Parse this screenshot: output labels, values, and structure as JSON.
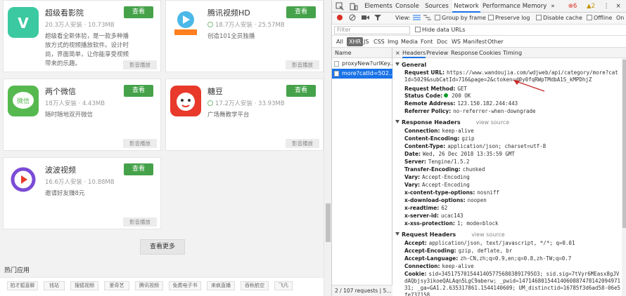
{
  "apps": [
    {
      "name": "超级看影院",
      "installs": "20.3万人安装",
      "size": "10.73MB",
      "desc": "超级看全新体验，是一款多种播放方式的视频播放软件。设计时尚，界面简单，让你能享受视频带来的乐趣。",
      "button": "查看",
      "tag": "影音播放",
      "color": "#3bc9a1"
    },
    {
      "name": "腾讯视频HD",
      "installs": "18.7万人安装",
      "size": "25.57MB",
      "desc": "创造101全员独播",
      "button": "查看",
      "tag": "影音播放",
      "color": "#ff7e1e"
    },
    {
      "name": "两个微信",
      "installs": "18万人安装",
      "size": "4.43MB",
      "desc": "随时随地双开微信",
      "button": "查看",
      "tag": "影音播放",
      "color": "#56b94f"
    },
    {
      "name": "糖豆",
      "installs": "17.2万人安装",
      "size": "33.93MB",
      "desc": "广场舞教学平台",
      "button": "查看",
      "tag": "影音播放",
      "color": "#e8392b"
    },
    {
      "name": "波波视频",
      "installs": "16.6万人安装",
      "size": "10.88MB",
      "desc": "邀请好友赚8元",
      "button": "查看",
      "tag": "影音播放",
      "color": "#7b4bd6"
    }
  ],
  "more_button": "查看更多",
  "hot": {
    "title": "热门应用",
    "items": [
      "拍才狐直聊",
      "钱站",
      "搜狐视频",
      "爱奇艺",
      "腾讯视频",
      "免费电子书",
      "来疯直播",
      "吞秋航空",
      "飞凡"
    ]
  },
  "devtools": {
    "tabs": [
      "Elements",
      "Console",
      "Sources",
      "Network",
      "Performance",
      "Memory"
    ],
    "active_tab": "Network",
    "badges": {
      "errors": "6",
      "warnings": "2"
    },
    "toolbar": {
      "view_label": "View:",
      "group_by_frame": "Group by frame",
      "preserve_log": "Preserve log",
      "disable_cache": "Disable cache",
      "offline": "Offline",
      "online": "On"
    },
    "filter": {
      "placeholder": "Filter",
      "hide_data_urls": "Hide data URLs"
    },
    "types": [
      "All",
      "XHR",
      "JS",
      "CSS",
      "Img",
      "Media",
      "Font",
      "Doc",
      "WS",
      "Manifest",
      "Other"
    ],
    "active_type": "XHR",
    "list": {
      "header": "Name",
      "requests": [
        "proxyNew?urlKey...",
        "more?catId=502..."
      ],
      "footer": "2 / 107 requests | 5..."
    },
    "detail_tabs": [
      "Headers",
      "Preview",
      "Response",
      "Cookies",
      "Timing"
    ],
    "general": {
      "title": "General",
      "request_url_label": "Request URL:",
      "request_url": "https://www.wandoujia.com/wdjweb/api/category/more?catId=5029&subCatId=716&page=2&ctoken=d0y0fqRWpTMdbA1S_kMPDhjZ",
      "request_method_label": "Request Method:",
      "request_method": "GET",
      "status_code_label": "Status Code:",
      "status_code": "200 OK",
      "remote_address_label": "Remote Address:",
      "remote_address": "123.150.182.244:443",
      "referrer_policy_label": "Referrer Policy:",
      "referrer_policy": "no-referrer-when-downgrade"
    },
    "response_headers": {
      "title": "Response Headers",
      "view_source": "view source",
      "rows": [
        [
          "Connection:",
          "keep-alive"
        ],
        [
          "Content-Encoding:",
          "gzip"
        ],
        [
          "Content-Type:",
          "application/json; charset=utf-8"
        ],
        [
          "Date:",
          "Wed, 26 Dec 2018 13:35:59 GMT"
        ],
        [
          "Server:",
          "Tengine/1.5.2"
        ],
        [
          "Transfer-Encoding:",
          "chunked"
        ],
        [
          "Vary:",
          "Accept-Encoding"
        ],
        [
          "Vary:",
          "Accept-Encoding"
        ],
        [
          "x-content-type-options:",
          "nosniff"
        ],
        [
          "x-download-options:",
          "noopen"
        ],
        [
          "x-readtime:",
          "62"
        ],
        [
          "x-server-id:",
          "ucac143"
        ],
        [
          "x-xss-protection:",
          "1; mode=block"
        ]
      ]
    },
    "request_headers": {
      "title": "Request Headers",
      "view_source": "view source",
      "rows": [
        [
          "Accept:",
          "application/json, text/javascript, */*; q=0.01"
        ],
        [
          "Accept-Encoding:",
          "gzip, deflate, br"
        ],
        [
          "Accept-Language:",
          "zh-CN,zh;q=0.9,en;q=0.8,zh-TW;q=0.7"
        ],
        [
          "Connection:",
          "keep-alive"
        ],
        [
          "Cookie:",
          "sid=34517570154414057756803891795O3; sid.sig=7tVyr6MEasx8gJVdAQbjsy3ikoeQALAqn5LgC9aberw; _pwid=1471468015441406088747814209497131; _ga=GA1.2.635317861.1544140609; UM_distinctid=16785f3d6ad58-06e5fe737158"
        ]
      ]
    }
  }
}
